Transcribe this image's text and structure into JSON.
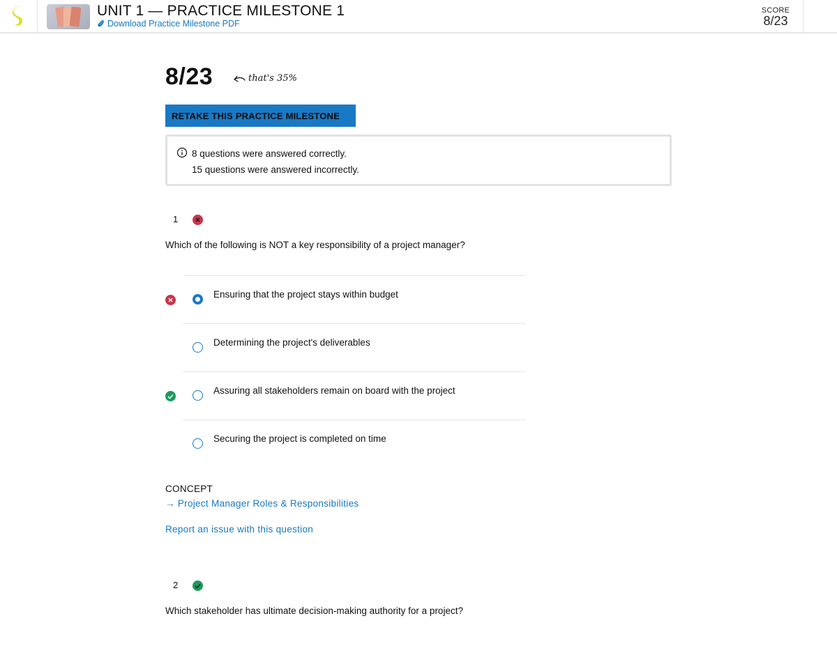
{
  "header": {
    "title": "UNIT 1 — PRACTICE MILESTONE 1",
    "pdf_link": "Download Practice Milestone PDF",
    "score_label": "SCORE",
    "score_value": "8/23"
  },
  "summary": {
    "score": "8/23",
    "percent_note": "that's 35%",
    "retake_label": "RETAKE THIS PRACTICE MILESTONE",
    "correct_text": "8 questions were answered correctly.",
    "incorrect_text": "15 questions were answered incorrectly."
  },
  "questions": [
    {
      "number": "1",
      "status": "incorrect",
      "text": "Which of the following is NOT a key responsibility of a project manager?",
      "answers": [
        {
          "text": "Ensuring that the project stays within budget",
          "selected": true,
          "mark": "wrong"
        },
        {
          "text": "Determining the project's deliverables",
          "selected": false,
          "mark": ""
        },
        {
          "text": "Assuring all stakeholders remain on board with the project",
          "selected": false,
          "mark": "right"
        },
        {
          "text": "Securing the project is completed on time",
          "selected": false,
          "mark": ""
        }
      ],
      "concept_label": "CONCEPT",
      "concept_link": "→ Project Manager Roles & Responsibilities",
      "report_link": "Report an issue with this question"
    },
    {
      "number": "2",
      "status": "correct",
      "text": "Which stakeholder has ultimate decision-making authority for a project?"
    }
  ],
  "colors": {
    "accent": "#1a79c4",
    "link": "#1578c2",
    "wrong": "#c8364a",
    "right": "#1c9a5e",
    "logo": "#d7e11a"
  },
  "icons": [
    "sophia-logo-icon",
    "paperclip-icon",
    "back-arrow-icon",
    "info-icon",
    "x-mark-icon",
    "check-mark-icon",
    "radio-icon"
  ]
}
